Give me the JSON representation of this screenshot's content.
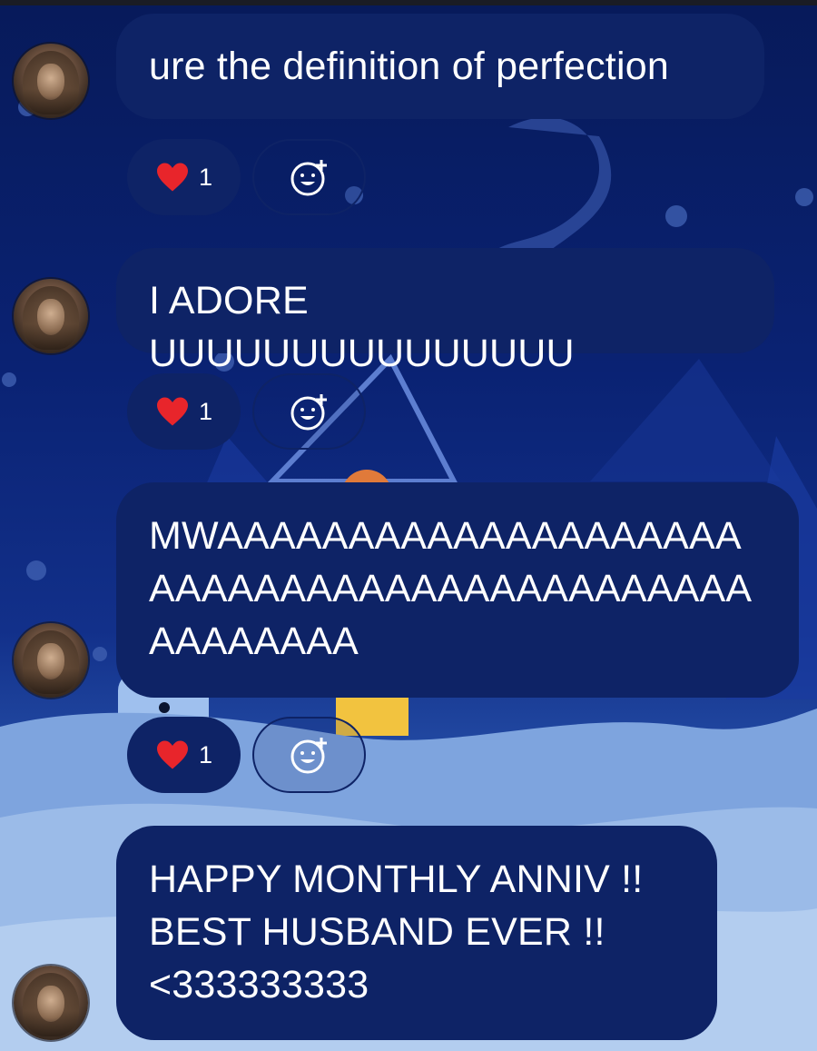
{
  "messages": [
    {
      "text": "ure the definition of perfection",
      "reactions": {
        "emoji": "heart",
        "count": "1",
        "add_icon": "emoji-add-icon"
      }
    },
    {
      "text": "I ADORE UUUUUUUUUUUUUUU",
      "reactions": {
        "emoji": "heart",
        "count": "1",
        "add_icon": "emoji-add-icon"
      }
    },
    {
      "text_lines": [
        "MWAAAAAAAAAAAAAAAAAAAA",
        "AAAAAAAAAAAAAAAAAAAAAAA",
        "AAAAAAAA"
      ],
      "reactions": {
        "emoji": "heart",
        "count": "1",
        "add_icon": "emoji-add-icon"
      }
    },
    {
      "text_lines": [
        "HAPPY MONTHLY ANNIV !!",
        "BEST HUSBAND EVER !!",
        "<333333333"
      ]
    }
  ],
  "colors": {
    "bubble": "#0e2366",
    "text": "#ffffff",
    "heart": "#e8252b",
    "background": "#0a2273"
  }
}
